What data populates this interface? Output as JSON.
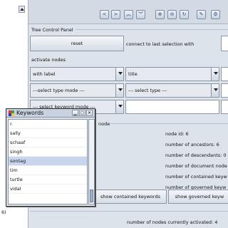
{
  "left_pane": {
    "partial_text": "6)"
  },
  "toolbar": {
    "buttons": [
      {
        "name": "back-button",
        "glyph": "<"
      },
      {
        "name": "forward-button",
        "glyph": ">"
      },
      {
        "name": "collapse-button",
        "glyph": "︽"
      },
      {
        "name": "expand-button",
        "glyph": "︾"
      },
      {
        "name": "up-button",
        "glyph": "⊕"
      },
      {
        "name": "down-button",
        "glyph": "⊖"
      },
      {
        "name": "refresh-button",
        "glyph": "↻"
      },
      {
        "name": "edit-button",
        "glyph": "✎"
      },
      {
        "name": "settings-button",
        "glyph": "⚙"
      }
    ]
  },
  "tree_panel": {
    "title": "Tree Control Panel",
    "reset_label": "reset",
    "connect_label": "connect to last selection with",
    "activate_label": "activate nodes",
    "row1_left": "with label",
    "row1_right": "title",
    "row2_left": "---select type mode ---",
    "row2_right": "--- select type ---",
    "row3_left": "--- select keyword mode ---",
    "node_section_label": "node",
    "stats": [
      "node id: 6",
      "number of ancestors: 6",
      "number of descendants: 0",
      "number of document node",
      "number of contained keyw",
      "number of governed keyw"
    ],
    "show_contained_label": "show contained keywords",
    "show_governed_label": "show governed keyw",
    "activated_count_text": "number of nodes currently activated: 4"
  },
  "keywords_dialog": {
    "title": "Keywords",
    "items": [
      "r.",
      "sally",
      "schaaf",
      "singh",
      "sontag",
      "tim",
      "turtle",
      "vidal"
    ],
    "selected": "sontag"
  }
}
